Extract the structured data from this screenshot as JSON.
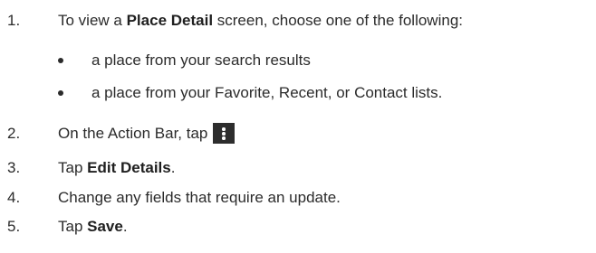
{
  "steps": [
    {
      "number": "1.",
      "prefix": "To view a ",
      "bold": "Place Detail",
      "suffix": " screen, choose one of the following:"
    },
    {
      "number": "2.",
      "prefix": "On the Action Bar, tap",
      "icon": "overflow-menu-icon"
    },
    {
      "number": "3.",
      "prefix": "Tap ",
      "bold": "Edit Details",
      "suffix": "."
    },
    {
      "number": "4.",
      "prefix": "Change any fields that require an update."
    },
    {
      "number": "5.",
      "prefix": "Tap ",
      "bold": "Save",
      "suffix": "."
    }
  ],
  "bullets": [
    "a place from your search results",
    "a place from your Favorite, Recent, or Contact lists."
  ],
  "colors": {
    "text": "#2b2b2b",
    "icon_background": "#2d2d2d"
  }
}
